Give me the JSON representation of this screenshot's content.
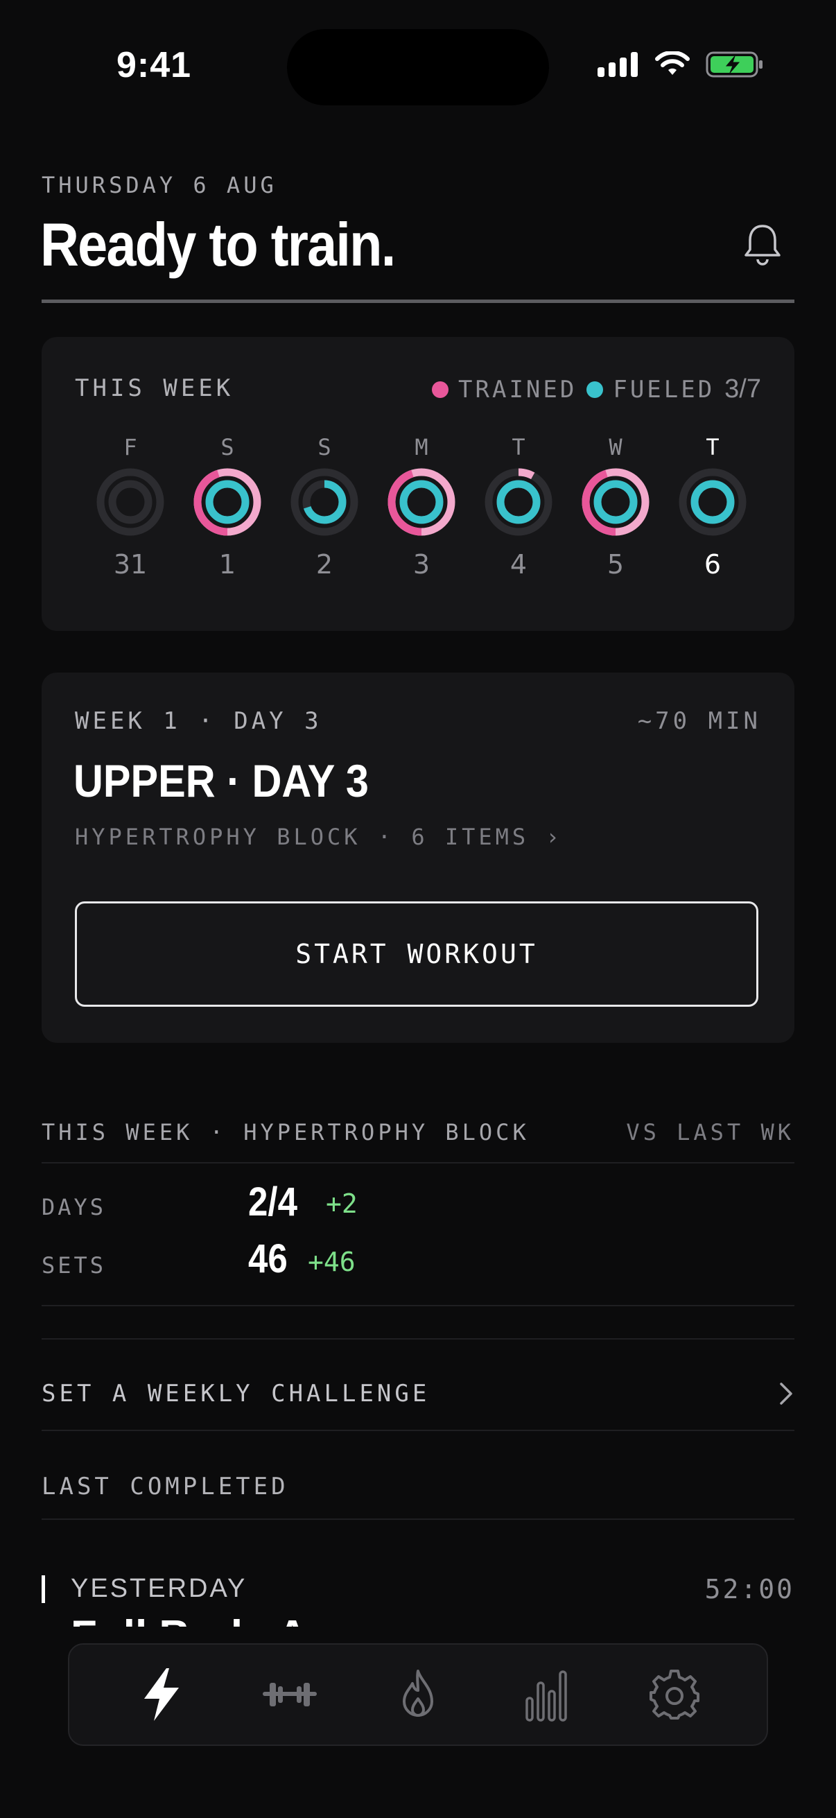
{
  "status_bar": {
    "time": "9:41"
  },
  "header": {
    "date": "THURSDAY 6 AUG",
    "title": "Ready to train."
  },
  "week": {
    "label": "THIS WEEK",
    "legend_trained": "TRAINED",
    "legend_fueled": "FUELED",
    "count": "3/7",
    "colors": {
      "trained": "#e8579a",
      "trained_light": "#f3a9cc",
      "fueled": "#39c2cc",
      "track": "#2c2c30"
    },
    "days": [
      {
        "letter": "F",
        "num": "31",
        "trained": 0,
        "fueled": 0,
        "today": false
      },
      {
        "letter": "S",
        "num": "1",
        "trained": 1,
        "fueled": 1,
        "today": false
      },
      {
        "letter": "S",
        "num": "2",
        "trained": 0,
        "fueled": 0.7,
        "today": false
      },
      {
        "letter": "M",
        "num": "3",
        "trained": 1,
        "fueled": 1,
        "today": false
      },
      {
        "letter": "T",
        "num": "4",
        "trained": 0.08,
        "fueled": 1,
        "today": false
      },
      {
        "letter": "W",
        "num": "5",
        "trained": 1,
        "fueled": 1,
        "today": false
      },
      {
        "letter": "T",
        "num": "6",
        "trained": 0,
        "fueled": 1,
        "today": true
      }
    ]
  },
  "workout": {
    "meta": "WEEK 1 · DAY 3",
    "duration": "~70 MIN",
    "name": "UPPER · DAY 3",
    "sub": "HYPERTROPHY BLOCK · 6 ITEMS ›",
    "start_label": "START WORKOUT"
  },
  "stats": {
    "heading": "THIS WEEK · HYPERTROPHY BLOCK",
    "compare": "VS LAST WK",
    "days_label": "DAYS",
    "days_value": "2/4",
    "days_delta": "+2",
    "sets_label": "SETS",
    "sets_value": "46",
    "sets_delta": "+46"
  },
  "challenge": {
    "label": "SET A WEEKLY CHALLENGE"
  },
  "last_completed": {
    "label": "LAST COMPLETED",
    "when": "YESTERDAY",
    "time": "52:00",
    "name": "Full Body A"
  },
  "tabbar": {
    "tabs": [
      {
        "icon": "bolt-icon",
        "active": true
      },
      {
        "icon": "dumbbell-icon",
        "active": false
      },
      {
        "icon": "flame-icon",
        "active": false
      },
      {
        "icon": "bar-chart-icon",
        "active": false
      },
      {
        "icon": "gear-icon",
        "active": false
      }
    ]
  }
}
